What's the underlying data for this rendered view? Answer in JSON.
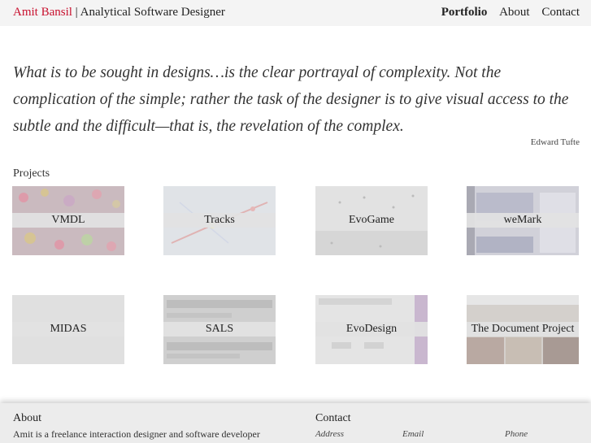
{
  "header": {
    "brand_name": "Amit Bansil",
    "separator": "|",
    "tagline": "Analytical Software Designer",
    "nav": [
      {
        "label": "Portfolio",
        "active": true
      },
      {
        "label": "About",
        "active": false
      },
      {
        "label": "Contact",
        "active": false
      }
    ],
    "accent_color": "#c8102e"
  },
  "quote": {
    "text": "What is to be sought in designs…is the clear portrayal of complexity.  Not the complication of the simple; rather the task of the designer is to give visual access to the subtle and the difficult—that is, the revelation of the complex.",
    "author": "Edward Tufte"
  },
  "projects": {
    "heading": "Projects",
    "items": [
      {
        "label": "VMDL"
      },
      {
        "label": "Tracks"
      },
      {
        "label": "EvoGame"
      },
      {
        "label": "weMark"
      },
      {
        "label": "MIDAS"
      },
      {
        "label": "SALS"
      },
      {
        "label": "EvoDesign"
      },
      {
        "label": "The Document Project"
      }
    ]
  },
  "footer": {
    "about_heading": "About",
    "about_text": "Amit is a freelance interaction designer and software developer",
    "contact_heading": "Contact",
    "address_label": "Address",
    "email_label": "Email",
    "phone_label": "Phone"
  }
}
